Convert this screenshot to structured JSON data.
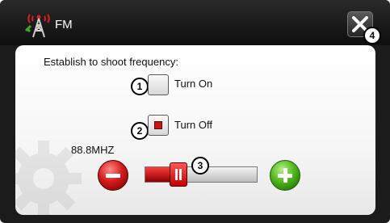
{
  "window": {
    "title": "FM",
    "icon": "fm-antenna-icon",
    "close_icon": "close-icon"
  },
  "panel": {
    "prompt": "Establish to shoot frequency:",
    "options": [
      {
        "label": "Turn On",
        "checked": false,
        "badge": "1"
      },
      {
        "label": "Turn Off",
        "checked": true,
        "badge": "2"
      }
    ],
    "frequency": {
      "value_text": "88.8MHZ",
      "slider_fraction": 0.26,
      "badge": "3",
      "decrease_icon": "minus-icon",
      "increase_icon": "plus-icon"
    },
    "close_badge": "4"
  },
  "colors": {
    "title_bar": "#1b1b1b",
    "panel_bg": "#ffffff",
    "accent_red": "#c41616",
    "accent_green": "#4fb81c"
  }
}
